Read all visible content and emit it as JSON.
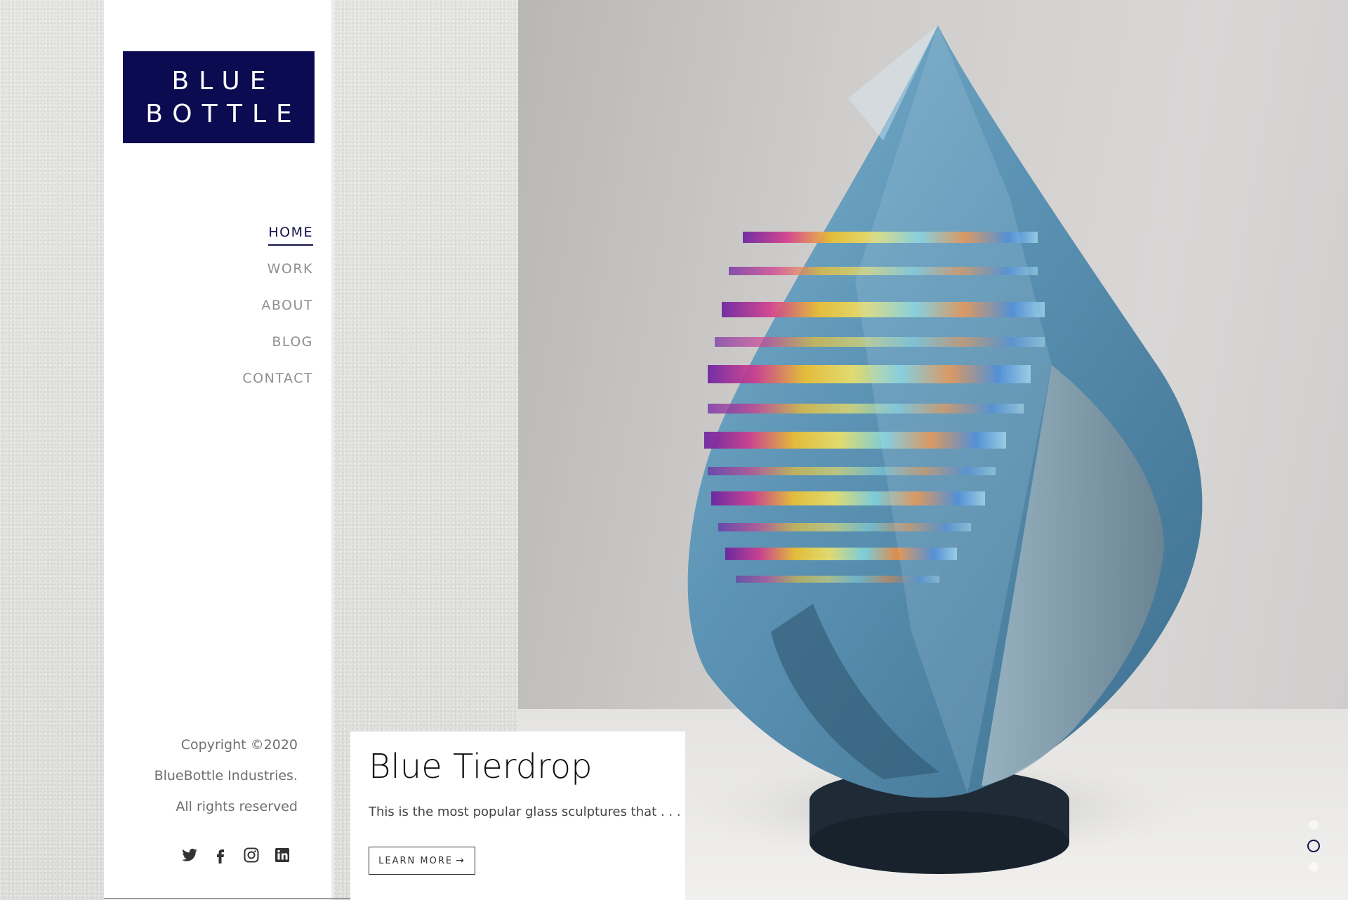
{
  "brand": {
    "line1": "BLUE",
    "line2": "BOTTLE",
    "bg_color": "#0b0b52"
  },
  "nav": {
    "items": [
      {
        "label": "HOME",
        "active": true
      },
      {
        "label": "WORK",
        "active": false
      },
      {
        "label": "ABOUT",
        "active": false
      },
      {
        "label": "BLOG",
        "active": false
      },
      {
        "label": "CONTACT",
        "active": false
      }
    ]
  },
  "footer": {
    "line1": "Copyright ©2020",
    "line2": "BlueBottle Industries.",
    "line3": "All rights reserved",
    "socials": [
      "twitter-icon",
      "facebook-icon",
      "instagram-icon",
      "linkedin-icon"
    ]
  },
  "slide": {
    "title": "Blue Tierdrop",
    "description": "This is the most popular glass sculptures that . . .",
    "button_label": "LEARN MORE",
    "button_icon": "arrow-right-icon",
    "image": "glass-teardrop-sculpture"
  },
  "slider": {
    "dot_count": 3,
    "active_index": 1
  },
  "colors": {
    "accent": "#12124a",
    "nav_inactive": "#8f8f8f"
  }
}
